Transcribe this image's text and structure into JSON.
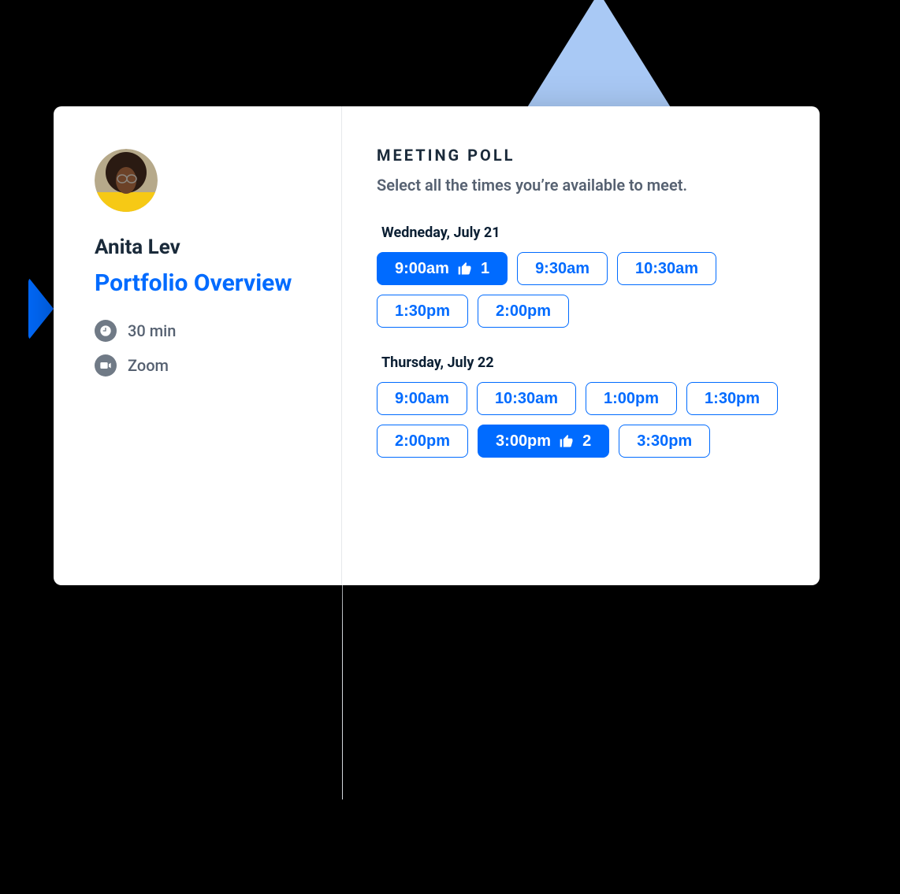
{
  "colors": {
    "accent": "#006bff",
    "text_dark": "#1a2a3a",
    "text_muted": "#566171",
    "triangle": "#a9c9f5"
  },
  "host": {
    "name": "Anita Lev",
    "meeting_title": "Portfolio Overview",
    "duration": "30 min",
    "video_platform": "Zoom"
  },
  "poll": {
    "heading": "MEETING POLL",
    "subheading": "Select all the times you’re available to meet.",
    "days": [
      {
        "label": "Wedneday, July 21",
        "slots": [
          {
            "time": "9:00am",
            "selected": true,
            "votes": 1
          },
          {
            "time": "9:30am",
            "selected": false
          },
          {
            "time": "10:30am",
            "selected": false
          },
          {
            "time": "1:30pm",
            "selected": false
          },
          {
            "time": "2:00pm",
            "selected": false
          }
        ]
      },
      {
        "label": "Thursday, July 22",
        "slots": [
          {
            "time": "9:00am",
            "selected": false
          },
          {
            "time": "10:30am",
            "selected": false
          },
          {
            "time": "1:00pm",
            "selected": false
          },
          {
            "time": "1:30pm",
            "selected": false
          },
          {
            "time": "2:00pm",
            "selected": false
          },
          {
            "time": "3:00pm",
            "selected": true,
            "votes": 2
          },
          {
            "time": "3:30pm",
            "selected": false
          }
        ]
      }
    ]
  }
}
